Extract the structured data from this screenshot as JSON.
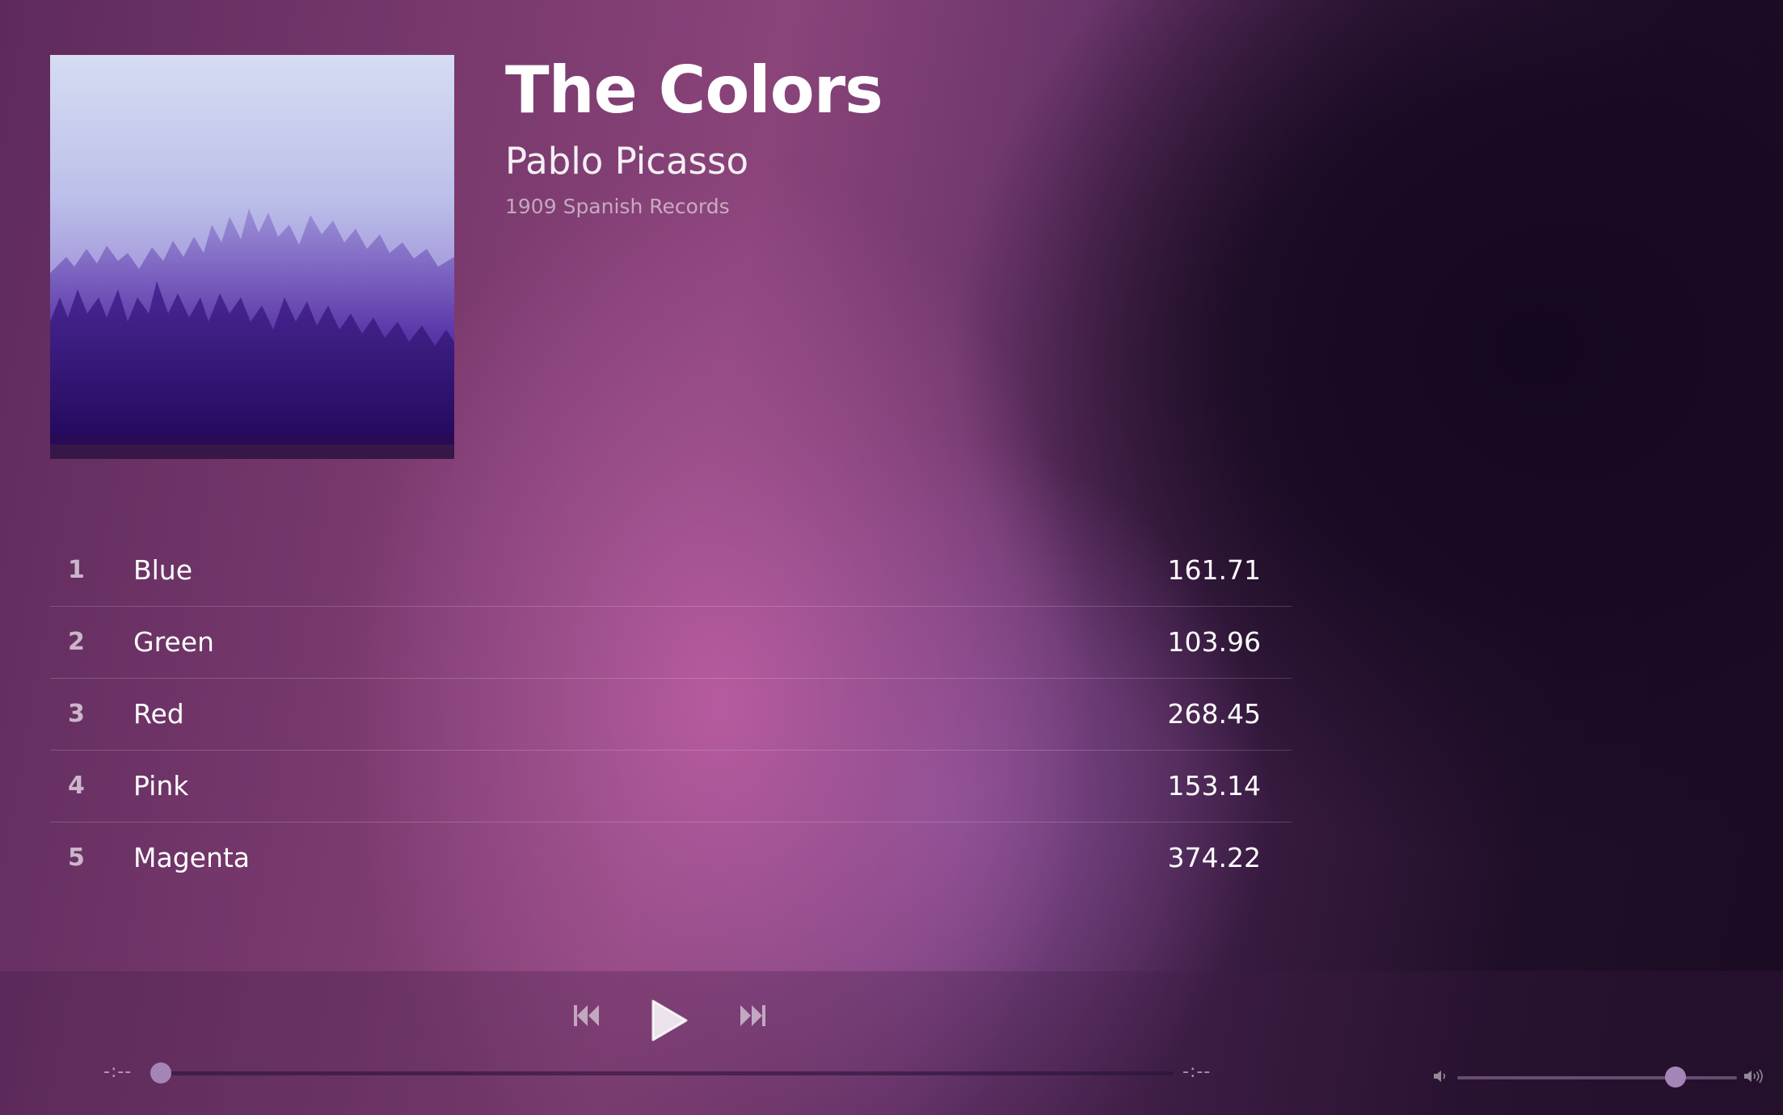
{
  "album": {
    "title": "The Colors",
    "artist": "Pablo Picasso",
    "label": "1909 Spanish Records",
    "cover_icon": "misty-forest-cover-image"
  },
  "tracks": [
    {
      "number": "1",
      "name": "Blue",
      "duration": "161.71"
    },
    {
      "number": "2",
      "name": "Green",
      "duration": "103.96"
    },
    {
      "number": "3",
      "name": "Red",
      "duration": "268.45"
    },
    {
      "number": "4",
      "name": "Pink",
      "duration": "153.14"
    },
    {
      "number": "5",
      "name": "Magenta",
      "duration": "374.22"
    }
  ],
  "player": {
    "elapsed": "-:--",
    "total": "-:--",
    "progress_fraction": 0.0,
    "volume_fraction": 0.78,
    "icons": {
      "previous": "skip-previous-icon",
      "play": "play-icon",
      "next": "skip-next-icon",
      "volume_low": "volume-low-icon",
      "volume_high": "volume-high-icon"
    }
  },
  "colors": {
    "accent_thumb": "#a486b6",
    "text_primary": "#ffffff"
  }
}
